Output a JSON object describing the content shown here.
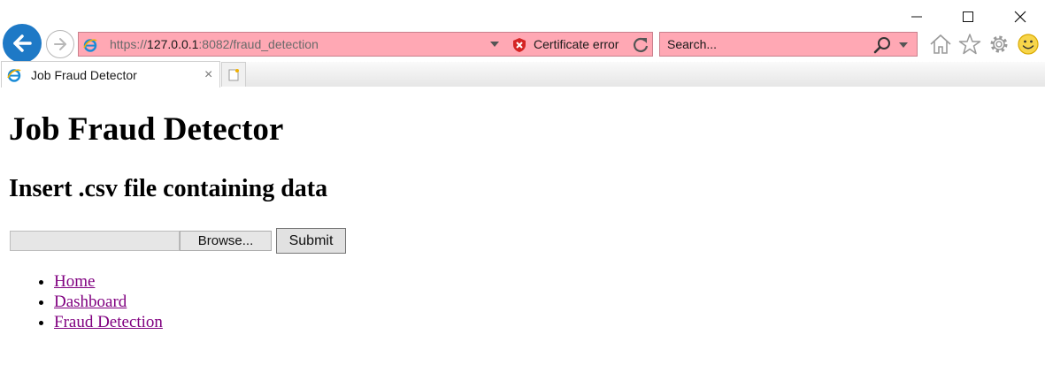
{
  "browser": {
    "url_scheme": "https://",
    "url_host": "127.0.0.1",
    "url_rest": ":8082/fraud_detection",
    "certificate_status": "Certificate error",
    "search_placeholder": "Search...",
    "address_bar_color": "#ffa8b4",
    "back_button_color": "#1e79c6"
  },
  "tab": {
    "title": "Job Fraud Detector",
    "close_glyph": "×"
  },
  "page": {
    "title": "Job Fraud Detector",
    "subtitle": "Insert .csv file containing data",
    "browse_label": "Browse...",
    "submit_label": "Submit",
    "nav_links": [
      {
        "label": "Home"
      },
      {
        "label": "Dashboard"
      },
      {
        "label": "Fraud Detection"
      }
    ],
    "link_color": "#800080"
  },
  "icons": [
    "minimize-icon",
    "maximize-icon",
    "close-icon",
    "back-arrow-icon",
    "forward-arrow-icon",
    "ie-logo-icon",
    "certificate-error-icon",
    "refresh-icon",
    "search-icon",
    "home-icon",
    "favorites-star-icon",
    "settings-gear-icon",
    "feedback-smiley-icon",
    "new-tab-icon"
  ]
}
